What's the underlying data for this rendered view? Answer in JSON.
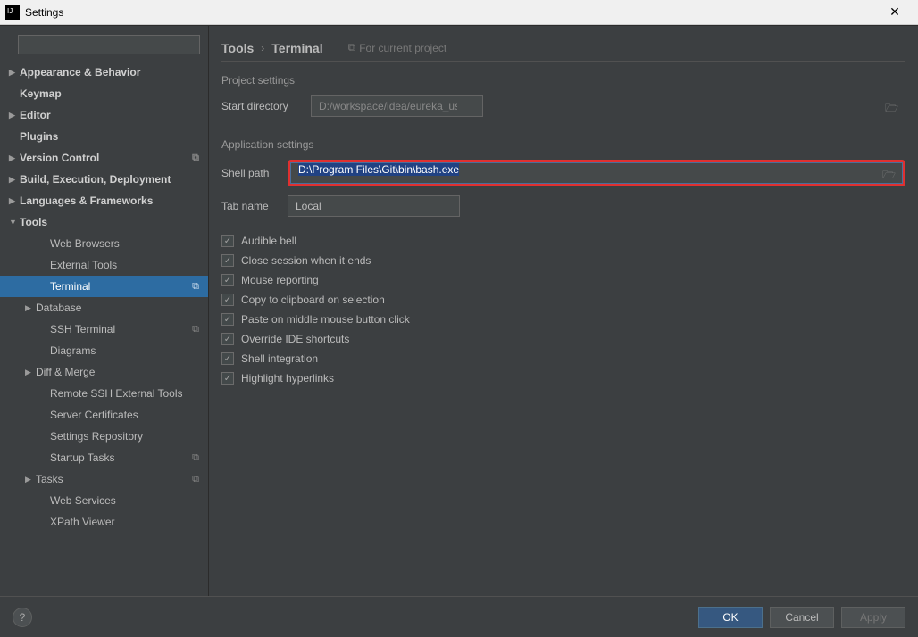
{
  "title": "Settings",
  "sidebar": {
    "search_placeholder": "",
    "items": [
      {
        "label": "Appearance & Behavior",
        "bold": true,
        "arrow": true
      },
      {
        "label": "Keymap",
        "bold": true
      },
      {
        "label": "Editor",
        "bold": true,
        "arrow": true
      },
      {
        "label": "Plugins",
        "bold": true
      },
      {
        "label": "Version Control",
        "bold": true,
        "arrow": true,
        "copy": true
      },
      {
        "label": "Build, Execution, Deployment",
        "bold": true,
        "arrow": true
      },
      {
        "label": "Languages & Frameworks",
        "bold": true,
        "arrow": true
      },
      {
        "label": "Tools",
        "bold": true,
        "arrow": true,
        "down": true,
        "children": [
          {
            "label": "Web Browsers"
          },
          {
            "label": "External Tools"
          },
          {
            "label": "Terminal",
            "selected": true,
            "copy": true
          },
          {
            "label": "Database",
            "arrow": true
          },
          {
            "label": "SSH Terminal",
            "copy": true
          },
          {
            "label": "Diagrams"
          },
          {
            "label": "Diff & Merge",
            "arrow": true
          },
          {
            "label": "Remote SSH External Tools"
          },
          {
            "label": "Server Certificates"
          },
          {
            "label": "Settings Repository"
          },
          {
            "label": "Startup Tasks",
            "copy": true
          },
          {
            "label": "Tasks",
            "arrow": true,
            "copy": true
          },
          {
            "label": "Web Services"
          },
          {
            "label": "XPath Viewer"
          }
        ]
      }
    ]
  },
  "breadcrumb": {
    "root": "Tools",
    "leaf": "Terminal",
    "proj": "For current project"
  },
  "section1": "Project settings",
  "start_dir_label": "Start directory",
  "start_dir_value": "D:/workspace/idea/eureka_user",
  "section2": "Application settings",
  "shell_path_label": "Shell path",
  "shell_path_value": "D:\\Program Files\\Git\\bin\\bash.exe",
  "tab_name_label": "Tab name",
  "tab_name_value": "Local",
  "checks": [
    "Audible bell",
    "Close session when it ends",
    "Mouse reporting",
    "Copy to clipboard on selection",
    "Paste on middle mouse button click",
    "Override IDE shortcuts",
    "Shell integration",
    "Highlight hyperlinks"
  ],
  "buttons": {
    "ok": "OK",
    "cancel": "Cancel",
    "apply": "Apply"
  }
}
